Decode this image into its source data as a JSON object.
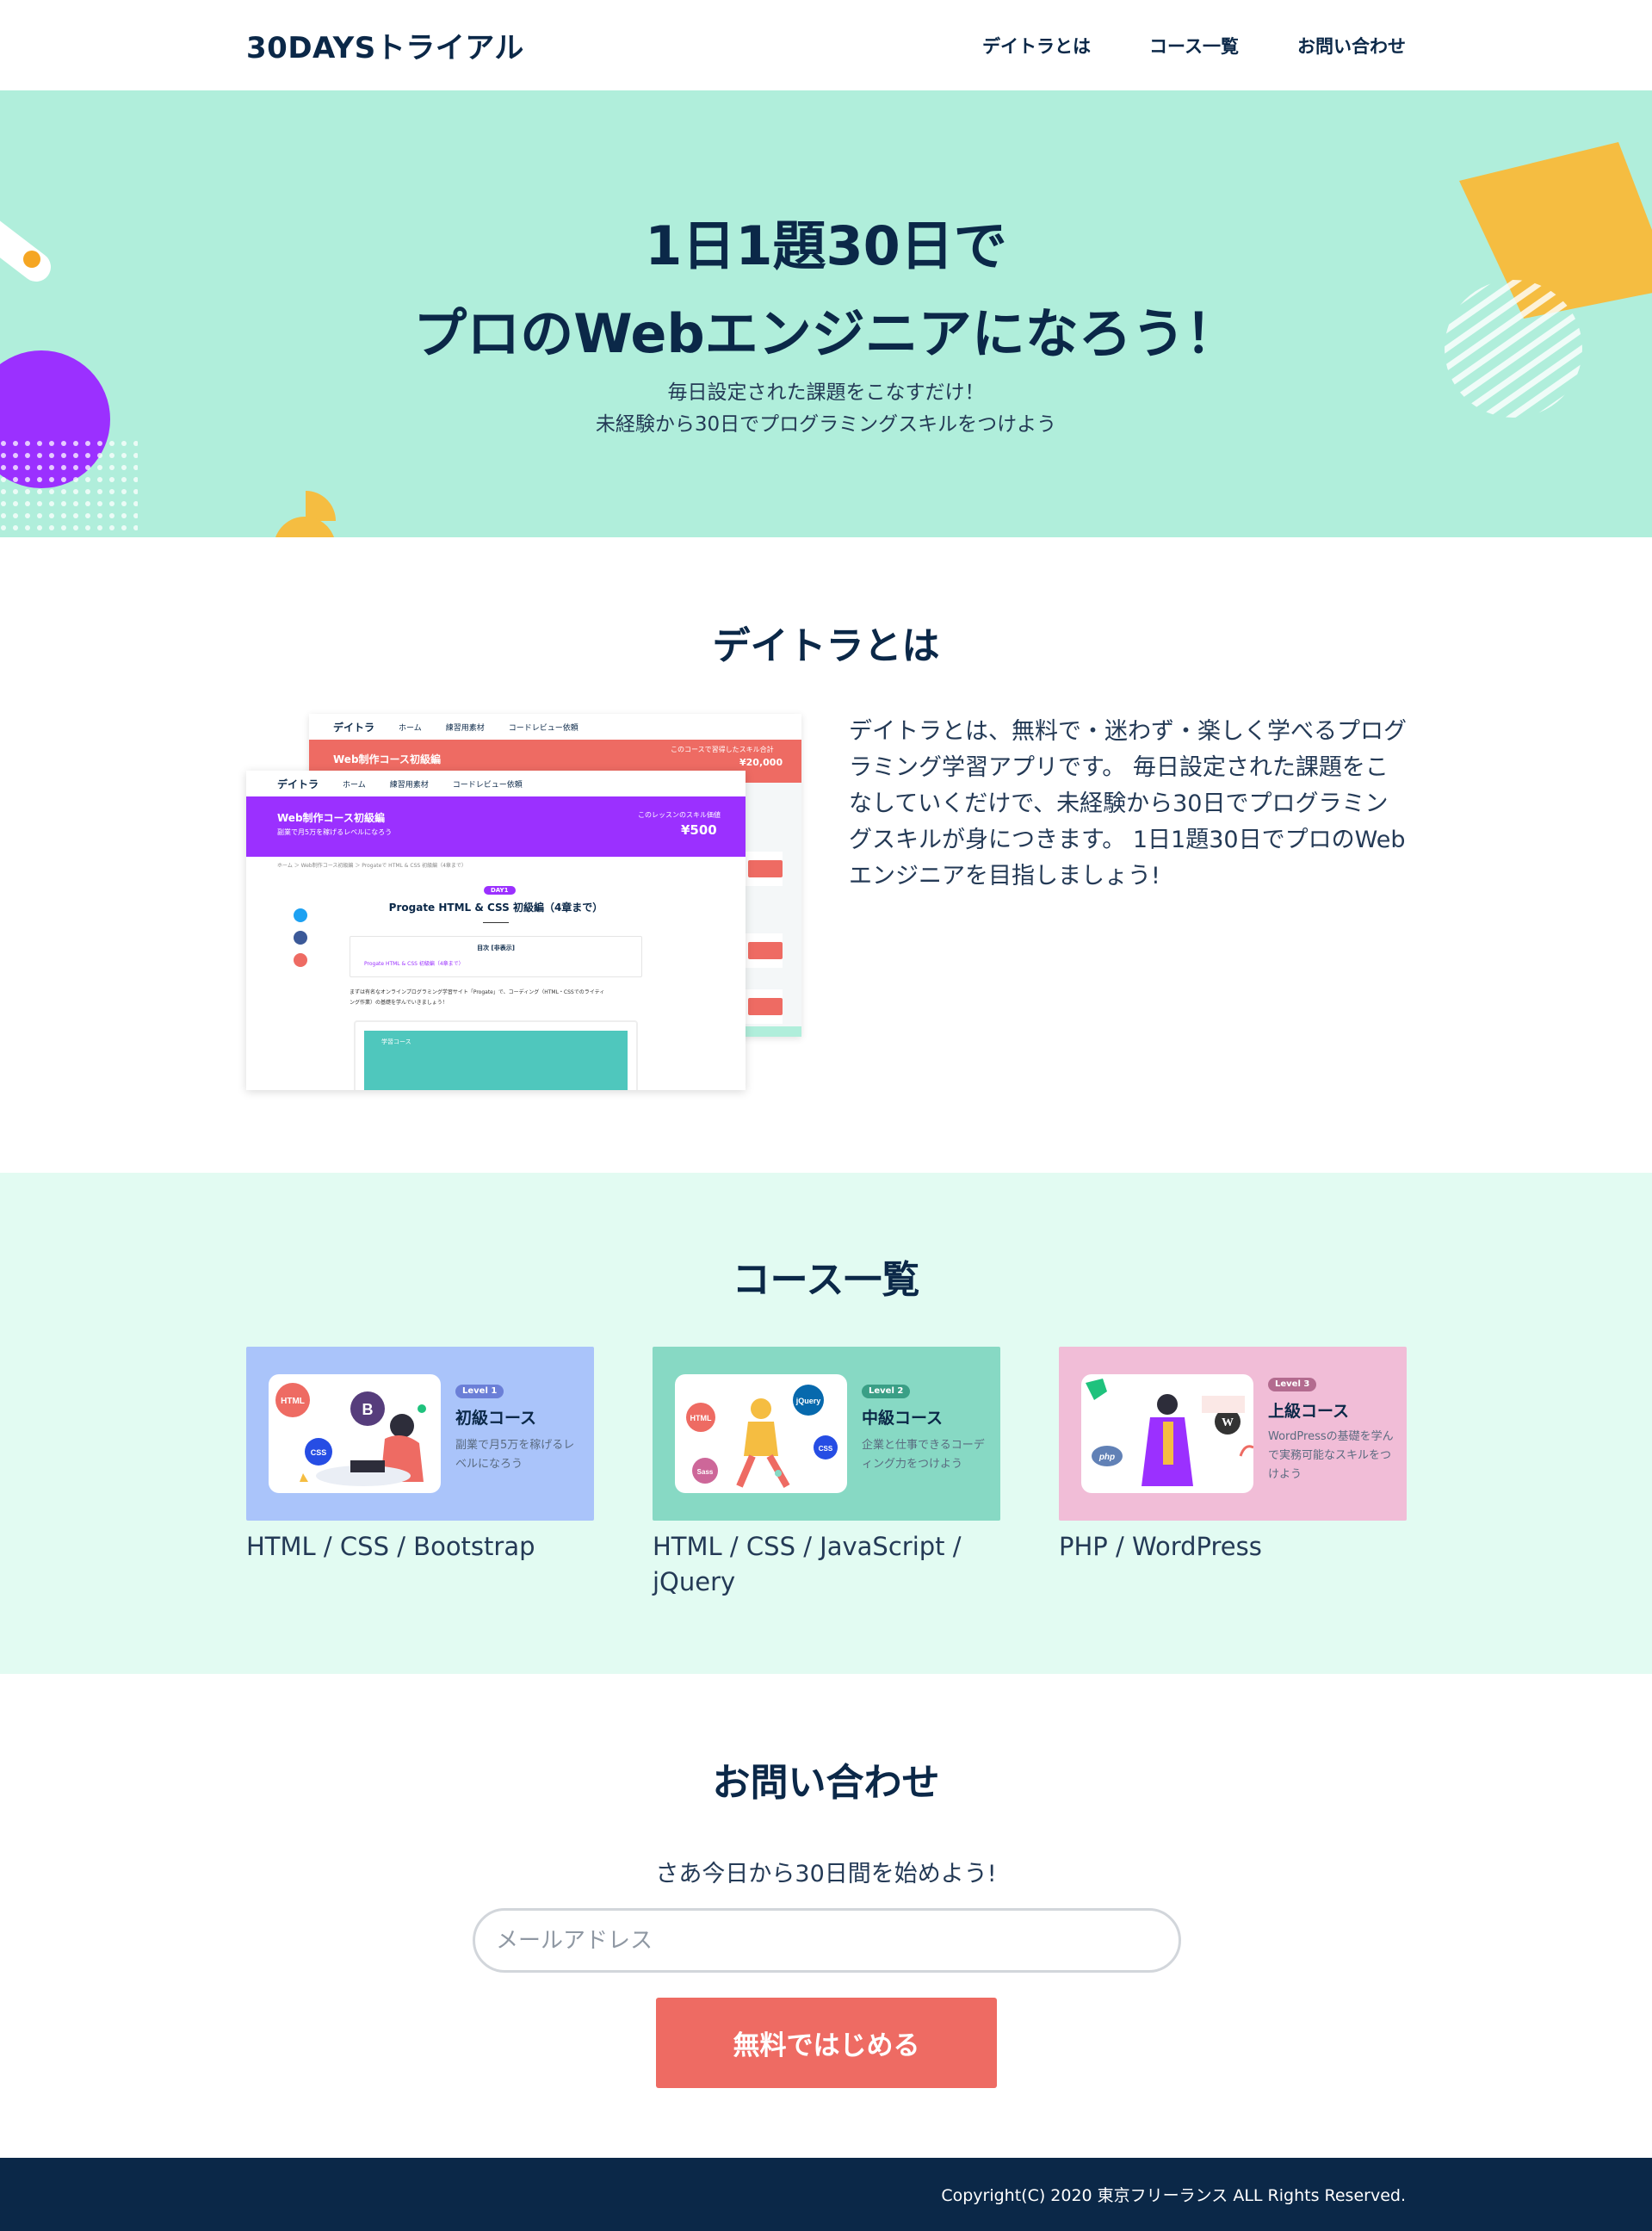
{
  "header": {
    "logo": "30DAYSトライアル",
    "nav": [
      "デイトラとは",
      "コース一覧",
      "お問い合わせ"
    ]
  },
  "hero": {
    "title_line1": "1日1題30日で",
    "title_line2": "プロのWebエンジニアになろう！",
    "sub_line1": "毎日設定された課題をこなすだけ！",
    "sub_line2": "未経験から30日でプログラミングスキルをつけよう"
  },
  "about": {
    "title": "デイトラとは",
    "text": "デイトラとは、無料で・迷わず・楽しく学べるプログラミング学習アプリです。 毎日設定された課題をこなしていくだけで、未経験から30日でプログラミングスキルが身につきます。 1日1題30日でプロのWebエンジニアを目指しましょう!",
    "mock": {
      "brand": "デイトラ",
      "nav": [
        "ホーム",
        "練習用素材",
        "コードレビュー依頼"
      ],
      "back_banner": "Web制作コース初級編",
      "back_right1": "このコースで習得したスキル合計",
      "back_price": "¥20,000",
      "front_banner": "Web制作コース初級編",
      "front_banner_sub": "副業で月5万を稼げるレベルになろう",
      "front_right1": "このレッスンのスキル価値",
      "front_price": "¥500",
      "breadcrumb": "ホーム ＞ Web制作コース初級編 ＞ Progateで HTML & CSS 初級編（4章まで）",
      "day": "DAY1",
      "lesson_title": "Progate HTML & CSS 初級編（4章まで）",
      "toc_title": "目次 [非表示]",
      "toc_item": "Progate HTML & CSS 初級編（4章まで）",
      "lesson_body": "まずは有名なオンラインプログラミング学習サイト「Progate」で、コーディング（HTML・CSSでのライティング作業）の基礎を学んでいきましょう！",
      "lesson_box": "学習コース"
    }
  },
  "courses": {
    "title": "コース一覧",
    "items": [
      {
        "level": "Level 1",
        "name": "初級コース",
        "desc": "副業で月5万を稼げるレベルになろう",
        "tags": "HTML / CSS / Bootstrap",
        "card_color": "#aac4fa",
        "level_color": "#6b7fd7"
      },
      {
        "level": "Level 2",
        "name": "中級コース",
        "desc": "企業と仕事できるコーディング力をつけよう",
        "tags": "HTML / CSS / JavaScript / jQuery",
        "card_color": "#87d9c4",
        "level_color": "#3a9f86"
      },
      {
        "level": "Level 3",
        "name": "上級コース",
        "desc": "WordPressの基礎を学んで実務可能なスキルをつけよう",
        "tags": "PHP / WordPress",
        "card_color": "#f1bdd7",
        "level_color": "#b36b8f"
      }
    ],
    "badges": {
      "html": "HTML",
      "bootstrap": "B",
      "css": "CSS",
      "jquery": "jQuery",
      "sass": "Sass",
      "php": "php",
      "wordpress": "W"
    }
  },
  "contact": {
    "title": "お問い合わせ",
    "lead": "さあ今日から30日間を始めよう!",
    "email_placeholder": "メールアドレス",
    "submit_label": "無料ではじめる"
  },
  "footer": {
    "copyright": "Copyright(C) 2020 東京フリーランス ALL Rights Reserved."
  },
  "colors": {
    "navy": "#0b2848",
    "hero_bg": "#b0eedb",
    "courses_bg": "#e2fbf2",
    "accent_coral": "#ee6b63",
    "accent_purple": "#9b30ff",
    "accent_yellow": "#f5bd41"
  }
}
